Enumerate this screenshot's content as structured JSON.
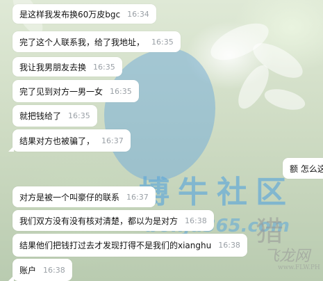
{
  "messages": [
    {
      "text": "是这样我发布换60万皮bgc",
      "time": "16:34"
    },
    {
      "text": "完了这个人联系我，给了我地址，",
      "time": "16:35"
    },
    {
      "text": "我让我男朋友去换",
      "time": "16:35"
    },
    {
      "text": "完了见到对方一男一女",
      "time": "16:35"
    },
    {
      "text": "就把钱给了",
      "time": "16:35"
    },
    {
      "text": "结果对方也被骗了，",
      "time": "16:37"
    },
    {
      "text": "对方是被一个叫豪仔的联系",
      "time": "16:37"
    },
    {
      "text": "我们双方没有没有核对清楚，都以为是对方",
      "time": "16:38"
    },
    {
      "text": "结果他们把钱打过去才发现打得不是我们的xianghu",
      "time": "16:38"
    },
    {
      "text": "账户",
      "time": "16:38"
    }
  ],
  "right_partial": {
    "text": "额 怎么这"
  },
  "watermark": {
    "brand": "博牛社区",
    "url": "bonju365.com",
    "seal_main": "猎",
    "seal_sub": "飞龙网",
    "seal_url": "www.FLW.PH"
  }
}
